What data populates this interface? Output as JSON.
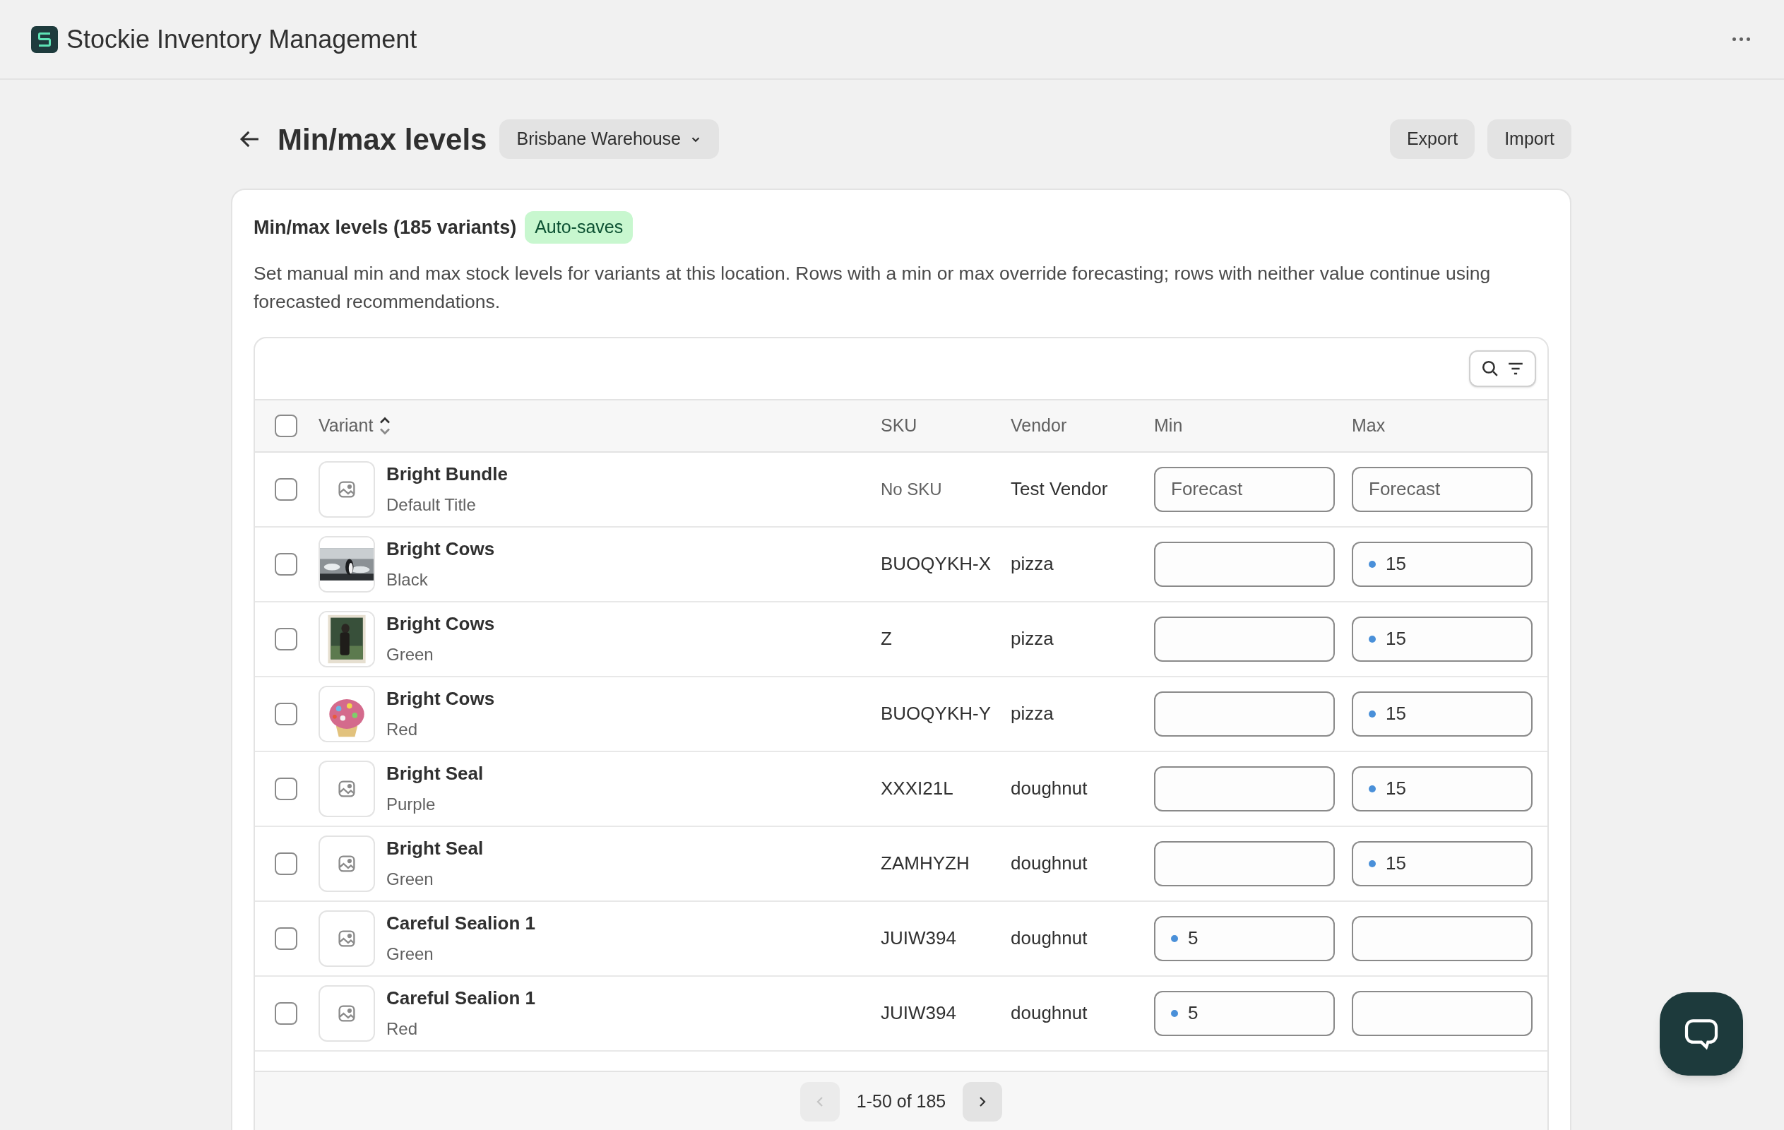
{
  "app": {
    "title": "Stockie Inventory Management"
  },
  "page": {
    "title": "Min/max levels",
    "location": "Brisbane Warehouse",
    "actions": [
      "Export",
      "Import"
    ]
  },
  "card": {
    "title": "Min/max levels (185 variants)",
    "badge": "Auto-saves",
    "description": "Set manual min and max stock levels for variants at this location. Rows with a min or max override forecasting; rows with neither value continue using forecasted recommendations."
  },
  "table": {
    "select_all": {
      "checked": false
    },
    "columns": [
      "Variant",
      "SKU",
      "Vendor",
      "Min",
      "Max"
    ],
    "rows": [
      {
        "thumbnail": {
          "kind": "placeholder"
        },
        "name": "Bright Bundle",
        "option": "Default Title",
        "sku": "No SKU",
        "sku_missing": true,
        "vendor": "Test Vendor",
        "min": {
          "placeholder": "Forecast"
        },
        "max": {
          "placeholder": "Forecast"
        },
        "checked": false
      },
      {
        "name": "Bright Cows",
        "option": "Black",
        "sku": "BUOQYKH-X",
        "sku_missing": false,
        "vendor": "pizza",
        "min": {},
        "max": {
          "value": "15"
        },
        "checked": false
      },
      {
        "name": "Bright Cows",
        "option": "Green",
        "sku": "Z",
        "sku_missing": false,
        "vendor": "pizza",
        "min": {},
        "max": {
          "value": "15"
        },
        "checked": false
      },
      {
        "name": "Bright Cows",
        "option": "Red",
        "sku": "BUOQYKH-Y",
        "sku_missing": false,
        "vendor": "pizza",
        "min": {},
        "max": {
          "value": "15"
        },
        "checked": false
      },
      {
        "thumbnail": {
          "kind": "placeholder"
        },
        "name": "Bright Seal",
        "option": "Purple",
        "sku": "XXXI21L",
        "sku_missing": false,
        "vendor": "doughnut",
        "min": {},
        "max": {
          "value": "15"
        },
        "checked": false
      },
      {
        "thumbnail": {
          "kind": "placeholder"
        },
        "name": "Bright Seal",
        "option": "Green",
        "sku": "ZAMHYZH",
        "sku_missing": false,
        "vendor": "doughnut",
        "min": {},
        "max": {
          "value": "15"
        },
        "checked": false
      },
      {
        "thumbnail": {
          "kind": "placeholder"
        },
        "name": "Careful Sealion 1",
        "option": "Green",
        "sku": "JUIW394",
        "sku_missing": false,
        "vendor": "doughnut",
        "min": {
          "value": "5"
        },
        "max": {},
        "checked": false
      },
      {
        "thumbnail": {
          "kind": "placeholder"
        },
        "name": "Careful Sealion 1",
        "option": "Red",
        "sku": "JUIW394",
        "sku_missing": false,
        "vendor": "doughnut",
        "min": {
          "value": "5"
        },
        "max": {},
        "checked": false
      }
    ],
    "pagination": {
      "label": "1-50 of 185",
      "previous_disabled": true,
      "next_disabled": false
    }
  }
}
